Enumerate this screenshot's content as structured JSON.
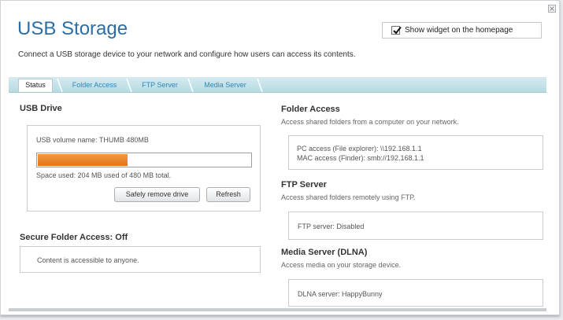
{
  "page": {
    "title": "USB Storage",
    "subtitle": "Connect a USB storage device to your network and configure how users can access its contents.",
    "show_widget_label": "Show widget on the homepage",
    "show_widget_checked": true
  },
  "tabs": [
    {
      "label": "Status",
      "active": true
    },
    {
      "label": "Folder Access",
      "active": false
    },
    {
      "label": "FTP Server",
      "active": false
    },
    {
      "label": "Media Server",
      "active": false
    }
  ],
  "usb_drive": {
    "heading": "USB Drive",
    "volume_label": "USB volume name: THUMB 480MB",
    "space_used_text": "Space used: 204 MB used of 480 MB total.",
    "used_fraction": 0.425,
    "safely_remove_label": "Safely remove drive",
    "refresh_label": "Refresh"
  },
  "secure_folder": {
    "heading": "Secure Folder Access: Off",
    "text": "Content is accessible to anyone."
  },
  "folder_access": {
    "heading": "Folder Access",
    "desc": "Access shared folders from a computer on your network.",
    "pc_access": "PC access (File explorer): \\\\192.168.1.1",
    "mac_access": "MAC access (Finder): smb://192.168.1.1"
  },
  "ftp_server": {
    "heading": "FTP Server",
    "desc": "Access shared folders remotely using FTP.",
    "status": "FTP server: Disabled"
  },
  "media_server": {
    "heading": "Media Server (DLNA)",
    "desc": "Access media on your storage device.",
    "status": "DLNA server: HappyBunny"
  },
  "colors": {
    "accent": "#2c6ea4",
    "tab_link": "#2f86b8",
    "progress": "#e8811f"
  },
  "icons": {
    "close": "close-icon",
    "checkbox": "checkmark-icon"
  }
}
